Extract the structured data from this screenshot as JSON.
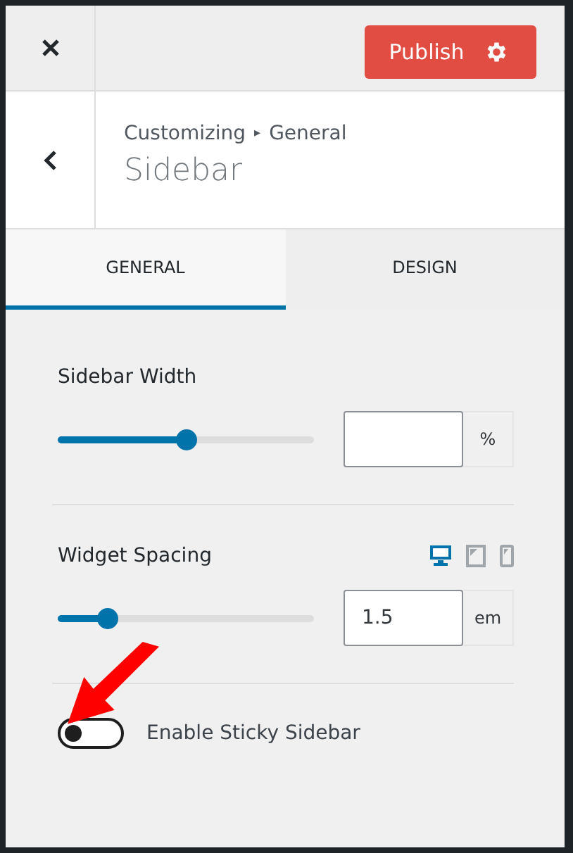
{
  "header": {
    "publish_label": "Publish"
  },
  "section": {
    "breadcrumb_root": "Customizing",
    "breadcrumb_separator": "▸",
    "breadcrumb_leaf": "General",
    "title": "Sidebar"
  },
  "tabs": [
    {
      "label": "GENERAL",
      "selected": true
    },
    {
      "label": "DESIGN",
      "selected": false
    }
  ],
  "controls": [
    {
      "kind": "slider",
      "label": "Sidebar Width",
      "level": 0.5,
      "unit": "%"
    },
    {
      "kind": "slider",
      "label": "Widget Spacing",
      "level": 0.19,
      "value": "1.5",
      "unit": "em",
      "devices": [
        {
          "kind": "desktop",
          "selected": true
        },
        {
          "kind": "tablet",
          "selected": false
        },
        {
          "kind": "mobile",
          "selected": false
        }
      ]
    },
    {
      "kind": "toggle",
      "label": "Enable Sticky Sidebar",
      "on": false,
      "annotated": true
    }
  ]
}
